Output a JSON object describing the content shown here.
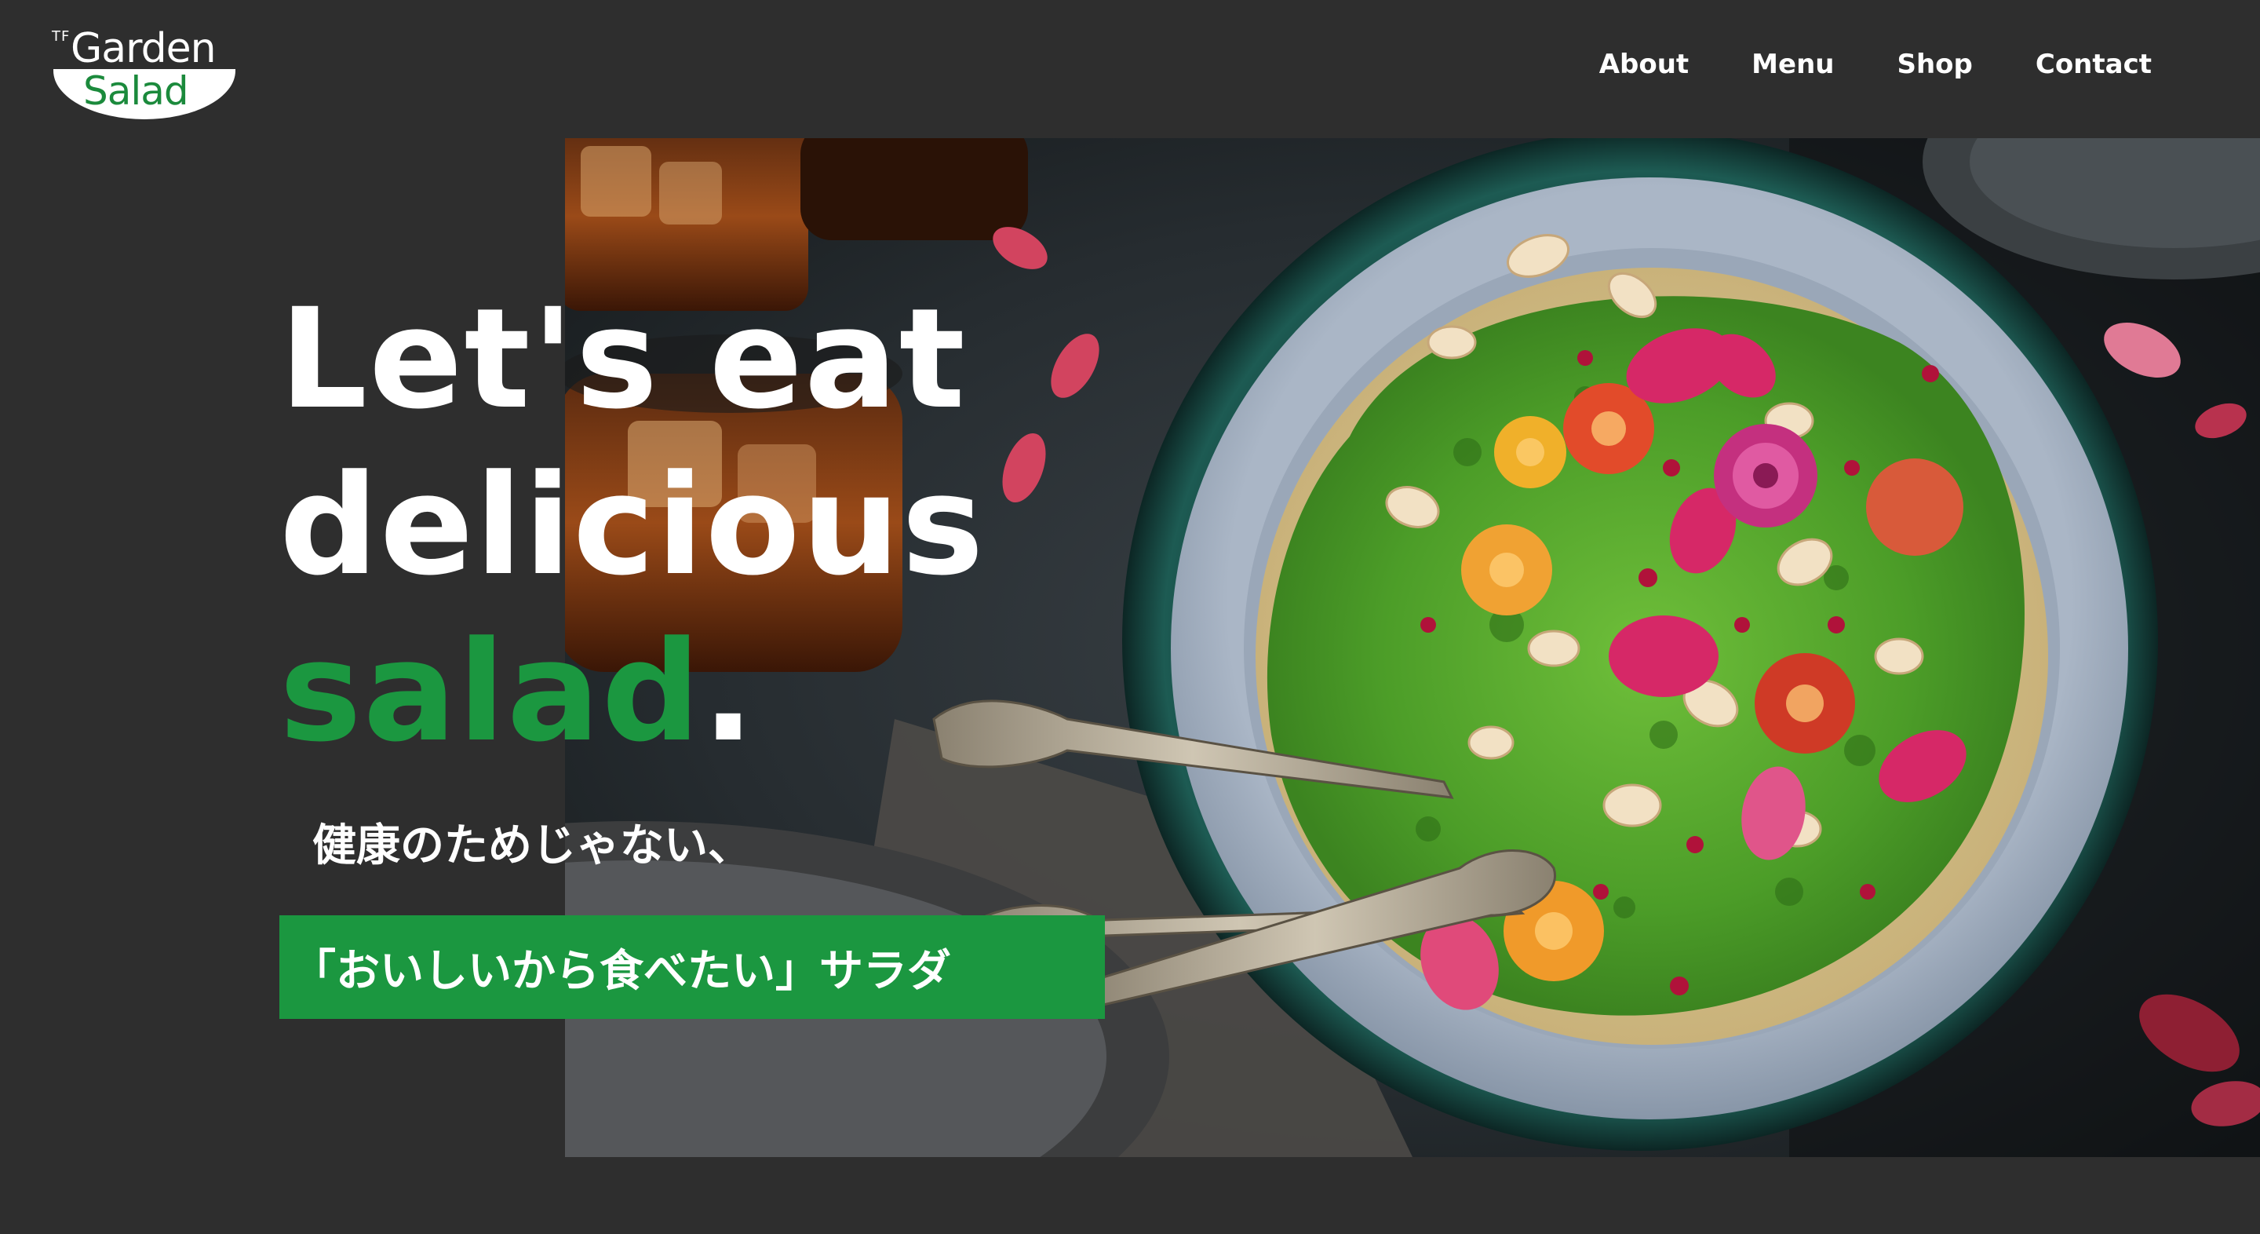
{
  "logo": {
    "tf": "TF",
    "top": "Garden",
    "bottom": "Salad"
  },
  "nav": {
    "items": [
      {
        "label": "About"
      },
      {
        "label": "Menu"
      },
      {
        "label": "Shop"
      },
      {
        "label": "Contact"
      }
    ]
  },
  "hero": {
    "line1": "Let's eat",
    "line2": "delicious",
    "line3_green": "salad",
    "line3_end": ".",
    "tagline": "健康のためじゃない、",
    "highlight": "「おいしいから食べたい」サラダ",
    "image_alt": "salad-bowl-photo"
  },
  "colors": {
    "background": "#2e2e2e",
    "accent_green": "#1b9740",
    "text": "#ffffff"
  }
}
